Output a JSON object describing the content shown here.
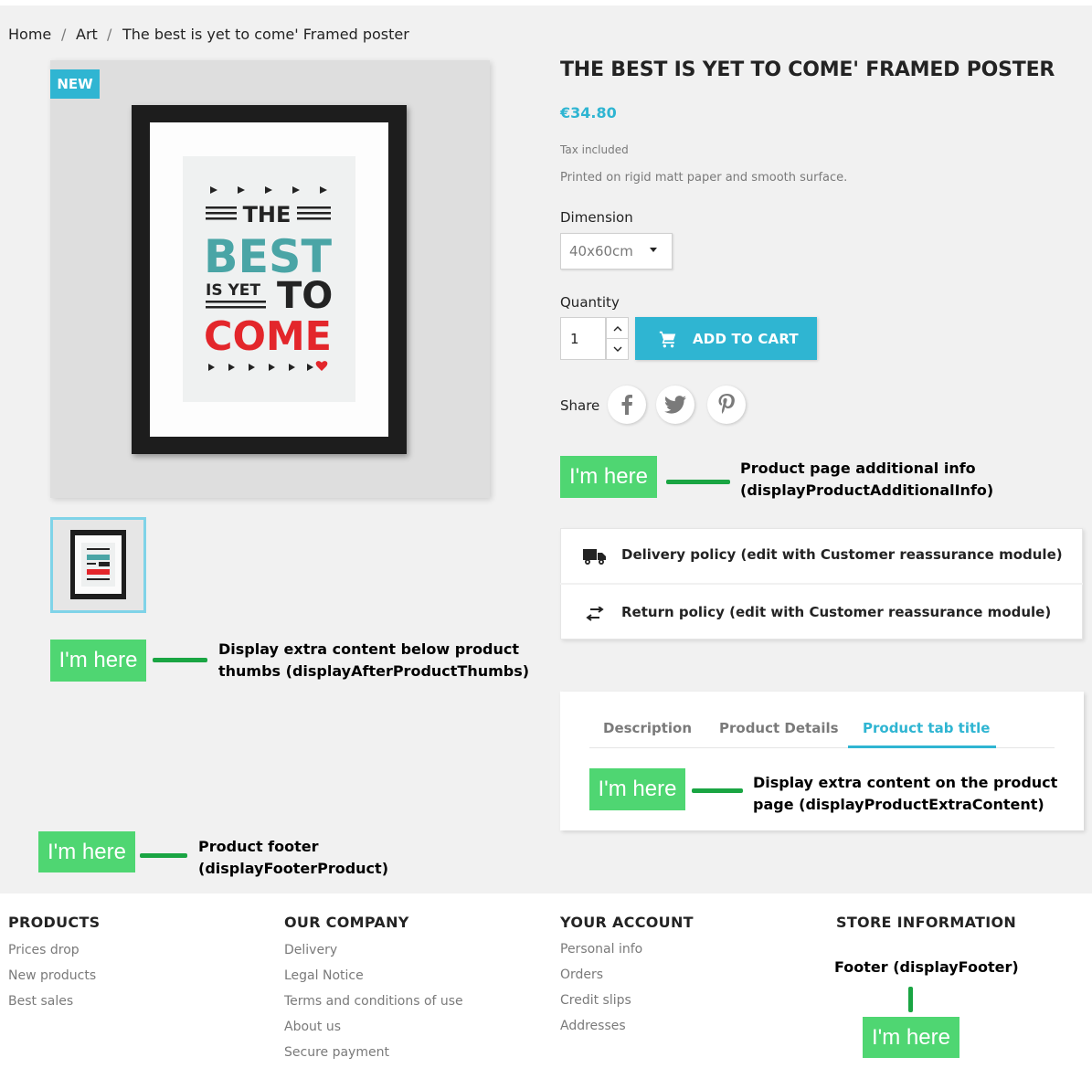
{
  "breadcrumb": {
    "items": [
      "Home",
      "Art",
      "The best is yet to come' Framed poster"
    ],
    "separator": "/"
  },
  "product": {
    "badge": "NEW",
    "title": "THE BEST IS YET TO COME' FRAMED POSTER",
    "price": "€34.80",
    "tax_note": "Tax included",
    "short_description": "Printed on rigid matt paper and smooth surface.",
    "dimension_label": "Dimension",
    "dimension_value": "40x60cm",
    "quantity_label": "Quantity",
    "quantity_value": "1",
    "add_to_cart": "ADD TO CART",
    "share_label": "Share",
    "social": [
      "facebook-icon",
      "twitter-icon",
      "pinterest-icon"
    ],
    "poster_text": {
      "line1": "THE",
      "line2": "BEST",
      "line3a": "IS YET",
      "line3b": "TO",
      "line4": "COME"
    }
  },
  "hooks": {
    "badge_text": "I'm here",
    "additional_info": {
      "line1": "Product page additional info",
      "line2": "(displayProductAdditionalInfo)"
    },
    "after_thumbs": {
      "line1": "Display extra content below product",
      "line2": "thumbs (displayAfterProductThumbs)"
    },
    "extra_content": {
      "line1": "Display extra content on the product",
      "line2": "page (displayProductExtraContent)"
    },
    "footer_product": {
      "line1": "Product footer",
      "line2": "(displayFooterProduct)"
    },
    "footer": "Footer (displayFooter)"
  },
  "reassurance": {
    "delivery": "Delivery policy (edit with Customer reassurance module)",
    "returns": "Return policy (edit with Customer reassurance module)"
  },
  "tabs": [
    {
      "label": "Description"
    },
    {
      "label": "Product Details"
    },
    {
      "label": "Product tab title"
    }
  ],
  "footer": {
    "products": {
      "heading": "PRODUCTS",
      "links": [
        "Prices drop",
        "New products",
        "Best sales"
      ]
    },
    "company": {
      "heading": "OUR COMPANY",
      "links": [
        "Delivery",
        "Legal Notice",
        "Terms and conditions of use",
        "About us",
        "Secure payment"
      ]
    },
    "account": {
      "heading": "YOUR ACCOUNT",
      "links": [
        "Personal info",
        "Orders",
        "Credit slips",
        "Addresses"
      ]
    },
    "store": {
      "heading": "STORE INFORMATION"
    }
  },
  "colors": {
    "accent": "#2fb5d2",
    "hook_green": "#4fd672",
    "connector_green": "#1aa543",
    "poster_teal": "#4aa5a6",
    "poster_red": "#e3262b"
  }
}
